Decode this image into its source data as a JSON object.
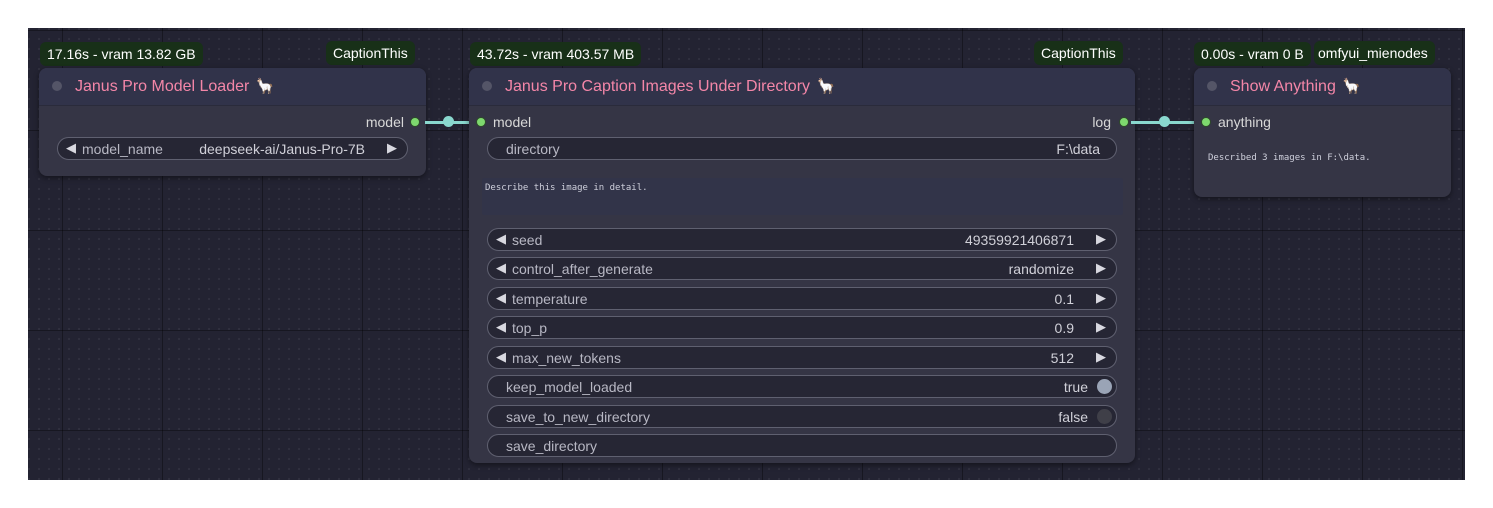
{
  "nodes": {
    "loader": {
      "badge_time": "17.16s - vram 13.82 GB",
      "badge_tag": "CaptionThis",
      "title": "Janus Pro Model Loader",
      "title_emoji": "🦙",
      "output_label": "model",
      "widgets": {
        "model_name_label": "model_name",
        "model_name_value": "deepseek-ai/Janus-Pro-7B"
      }
    },
    "captioner": {
      "badge_time": "43.72s - vram 403.57 MB",
      "badge_tag": "CaptionThis",
      "title": "Janus Pro Caption Images Under Directory",
      "title_emoji": "🦙",
      "input_label": "model",
      "output_label": "log",
      "directory_label": "directory",
      "directory_value": "F:\\data",
      "prompt_text": "Describe this image in detail.",
      "widgets": [
        {
          "label": "seed",
          "value": "49359921406871"
        },
        {
          "label": "control_after_generate",
          "value": "randomize"
        },
        {
          "label": "temperature",
          "value": "0.1"
        },
        {
          "label": "top_p",
          "value": "0.9"
        },
        {
          "label": "max_new_tokens",
          "value": "512"
        }
      ],
      "toggles": [
        {
          "label": "keep_model_loaded",
          "value": "true",
          "color": "#9aa4b6"
        },
        {
          "label": "save_to_new_directory",
          "value": "false",
          "color": "#3f3f48"
        }
      ],
      "save_directory_label": "save_directory"
    },
    "show": {
      "badge_time": "0.00s - vram 0 B",
      "badge_tag": "omfyui_mienodes",
      "title": "Show Anything",
      "title_emoji": "🦙",
      "input_label": "anything",
      "output_text": "Described 3 images in F:\\data."
    }
  },
  "icons": {
    "left_arrow": "◀",
    "right_arrow": "▶"
  },
  "colors": {
    "title": "#f486a8",
    "badge_bg": "#183018",
    "link": "#8ad8cf",
    "slot": "#7ed86e",
    "canvas": "#232332"
  }
}
